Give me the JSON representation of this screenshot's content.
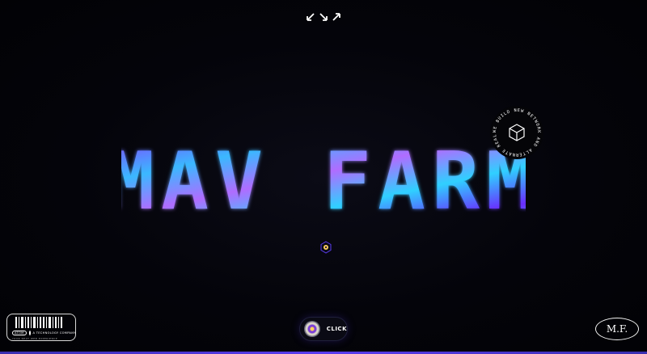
{
  "hero": {
    "title": "MAV FARM"
  },
  "badge": {
    "text": "WE BUILD NEW NETWORK AND ALTERNATE REALITY"
  },
  "logo": {
    "brand": "ATOM",
    "tagline": "A TECHNOLOGY COMPANY",
    "subtext": "YOUR NEXT WEB EXPERIENCE"
  },
  "click_button": {
    "label": "CLICK"
  },
  "mf_button": {
    "label": "M.F."
  },
  "colors": {
    "background": "#030306",
    "title_blue": "#3ab8ff",
    "title_violet": "#8a3cff",
    "accent_line": "#5a3cf0",
    "center_dot": "#ffd25a"
  },
  "icons": [
    "collapse-arrow-icon",
    "diagonal-arrow-icon",
    "expand-arrow-icon",
    "cube-icon",
    "atom-dot-icon"
  ]
}
